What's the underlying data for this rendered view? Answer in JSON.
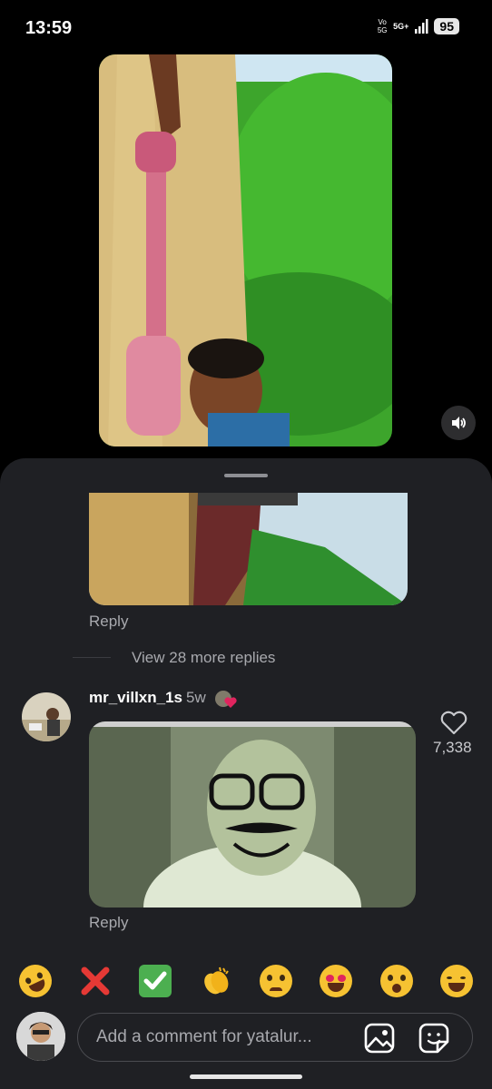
{
  "status_bar": {
    "time": "13:59",
    "volte": "Vo 5G",
    "network": "5G+",
    "battery": "95"
  },
  "video": {
    "mute_icon": "speaker-icon"
  },
  "comments": {
    "reply_label": "Reply",
    "view_more": "View 28 more replies",
    "comment": {
      "username": "mr_villxn_1s",
      "time_ago": "5w",
      "like_count": "7,338",
      "reply_label": "Reply"
    }
  },
  "reactions": [
    "🤣",
    "❌",
    "✅",
    "👏",
    "😢",
    "😍",
    "😮",
    "😂"
  ],
  "composer": {
    "placeholder": "Add a comment for yatalur..."
  },
  "colors": {
    "sheet_bg": "#1f2024",
    "secondary_text": "#a8a9ae",
    "heart_red": "#e0245e"
  }
}
